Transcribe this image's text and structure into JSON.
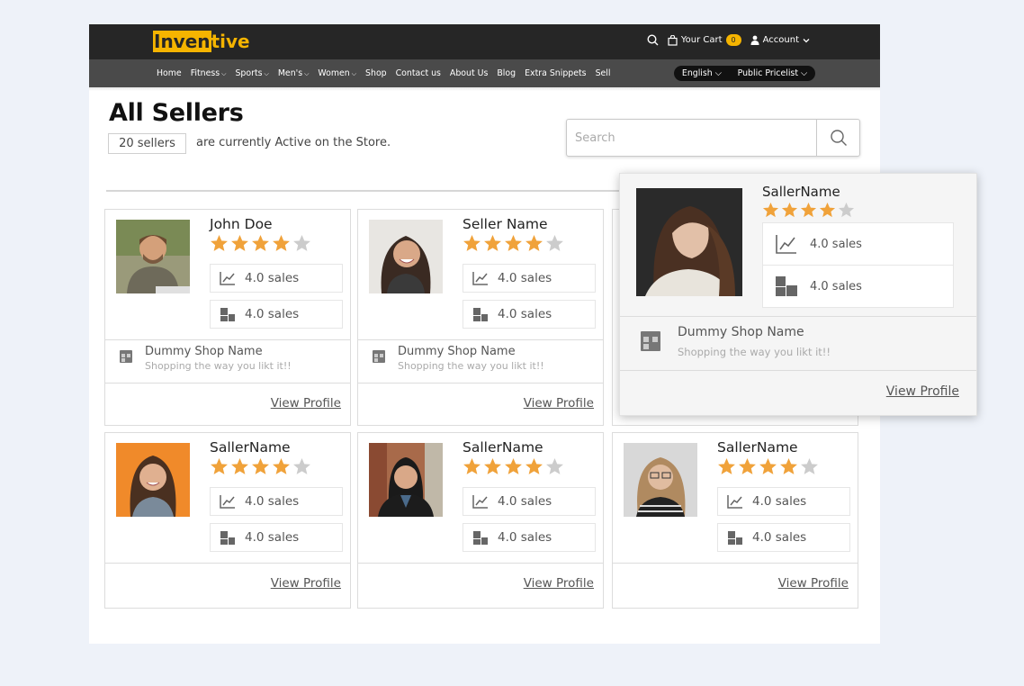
{
  "brand": {
    "logo_hl": "Inven",
    "logo_rest": "tive"
  },
  "header": {
    "cart_label": "Your Cart",
    "cart_count": "0",
    "account_label": "Account"
  },
  "nav": {
    "links": [
      "Home",
      "Fitness",
      "Sports",
      "Men's",
      "Women",
      "Shop",
      "Contact us",
      "About Us",
      "Blog",
      "Extra Snippets",
      "Sell"
    ],
    "language": "English",
    "pricelist": "Public Pricelist"
  },
  "page": {
    "title": "All Sellers",
    "seller_count": "20 sellers",
    "count_text": "are currently Active on the Store.",
    "search_placeholder": "Search"
  },
  "colors": {
    "accent": "#f5b400",
    "star": "#f0a23a",
    "star_empty": "#cccccc"
  },
  "sellers": [
    {
      "name": "John Doe",
      "rating": 4,
      "sales": "4.0 sales",
      "orders": "4.0 sales",
      "shop_name": "Dummy Shop Name",
      "shop_slogan": "Shopping the way you likt it!!",
      "view_label": "View Profile"
    },
    {
      "name": "Seller Name",
      "rating": 4,
      "sales": "4.0 sales",
      "orders": "4.0 sales",
      "shop_name": "Dummy Shop Name",
      "shop_slogan": "Shopping the way you likt it!!",
      "view_label": "View Profile"
    },
    {
      "name": "SallerName",
      "rating": 4,
      "sales": "4.0 sales",
      "orders": "4.0 sales",
      "view_label": "View Profile"
    },
    {
      "name": "SallerName",
      "rating": 4,
      "sales": "4.0 sales",
      "orders": "4.0 sales",
      "view_label": "View Profile"
    },
    {
      "name": "SallerName",
      "rating": 4,
      "sales": "4.0 sales",
      "orders": "4.0 sales",
      "view_label": "View Profile"
    }
  ],
  "popup": {
    "name": "SallerName",
    "rating": 4,
    "sales": "4.0 sales",
    "orders": "4.0 sales",
    "shop_name": "Dummy Shop Name",
    "shop_slogan": "Shopping the way you likt it!!",
    "view_label": "View Profile"
  }
}
